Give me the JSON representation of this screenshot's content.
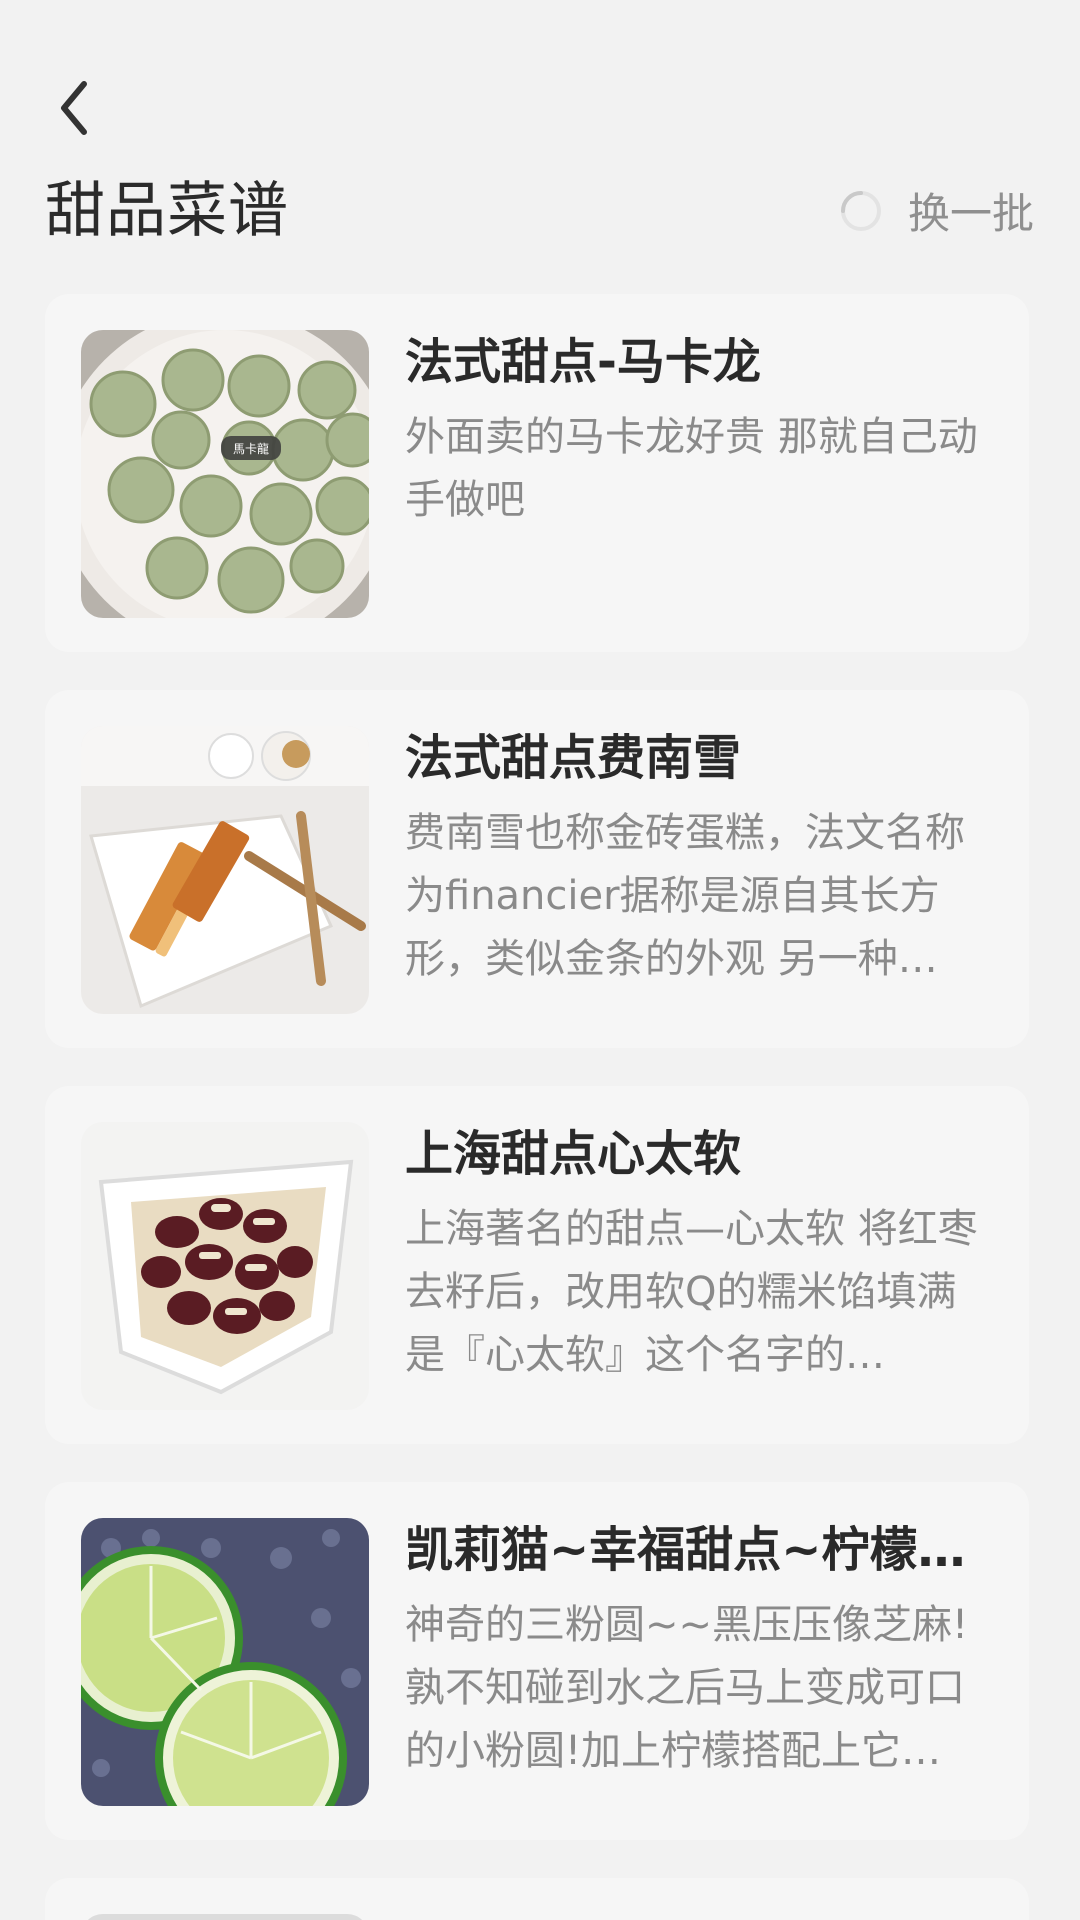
{
  "header": {
    "back_icon": "chevron-left-icon",
    "title": "甜品菜谱",
    "refresh_label": "换一批",
    "refresh_icon": "loading-spinner-icon"
  },
  "recipes": [
    {
      "title": "法式甜点-马卡龙",
      "desc": "外面卖的马卡龙好贵 那就自己动手做吧",
      "image_label": "馬卡龍"
    },
    {
      "title": "法式甜点费南雪",
      "desc": "费南雪也称金砖蛋糕，法文名称为financier据称是源自其长方形，类似金条的外观 另一种…"
    },
    {
      "title": "上海甜点心太软",
      "desc": "上海著名的甜点—心太软 将红枣去籽后，改用软Q的糯米馅填满 是『心太软』这个名字的…"
    },
    {
      "title": "凯莉猫~幸福甜点~柠檬山…",
      "desc": "神奇的三粉圆~~黑压压像芝麻!孰不知碰到水之后马上变成可口的小粉圆!加上柠檬搭配上它…"
    }
  ],
  "colors": {
    "background": "#f2f2f2",
    "card": "#f6f6f6",
    "title_text": "#2a2a2a",
    "desc_text": "#8a8a8a"
  }
}
